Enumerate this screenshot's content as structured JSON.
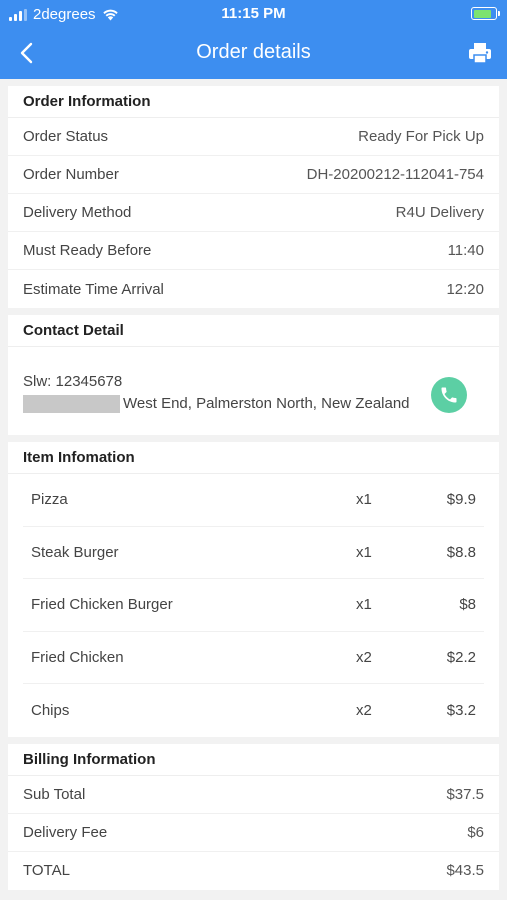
{
  "status_bar": {
    "carrier": "2degrees",
    "time": "11:15 PM"
  },
  "header": {
    "title": "Order details"
  },
  "order_info": {
    "title": "Order Information",
    "rows": [
      {
        "label": "Order Status",
        "value": "Ready For Pick Up"
      },
      {
        "label": "Order Number",
        "value": "DH-20200212-112041-754"
      },
      {
        "label": "Delivery Method",
        "value": "R4U Delivery"
      },
      {
        "label": "Must Ready Before",
        "value": "11:40"
      },
      {
        "label": "Estimate Time Arrival",
        "value": "12:20"
      }
    ]
  },
  "contact": {
    "title": "Contact Detail",
    "name_phone": "Slw: 12345678",
    "address": "West End, Palmerston North, New Zealand"
  },
  "items": {
    "title": "Item Infomation",
    "list": [
      {
        "name": "Pizza",
        "qty": "x1",
        "price": "$9.9"
      },
      {
        "name": "Steak Burger",
        "qty": "x1",
        "price": "$8.8"
      },
      {
        "name": "Fried Chicken Burger",
        "qty": "x1",
        "price": "$8"
      },
      {
        "name": "Fried Chicken",
        "qty": "x2",
        "price": "$2.2"
      },
      {
        "name": "Chips",
        "qty": "x2",
        "price": "$3.2"
      }
    ]
  },
  "billing": {
    "title": "Billing Information",
    "rows": [
      {
        "label": "Sub Total",
        "value": "$37.5"
      },
      {
        "label": "Delivery Fee",
        "value": "$6"
      },
      {
        "label": "TOTAL",
        "value": "$43.5"
      }
    ]
  },
  "colors": {
    "accent": "#3d8ef0",
    "call_button": "#5ccfa4",
    "battery": "#7de36f"
  },
  "icons": {
    "back": "chevron-left-icon",
    "print": "printer-icon",
    "call": "phone-icon",
    "wifi": "wifi-icon",
    "signal": "signal-icon",
    "battery": "battery-charging-icon"
  }
}
